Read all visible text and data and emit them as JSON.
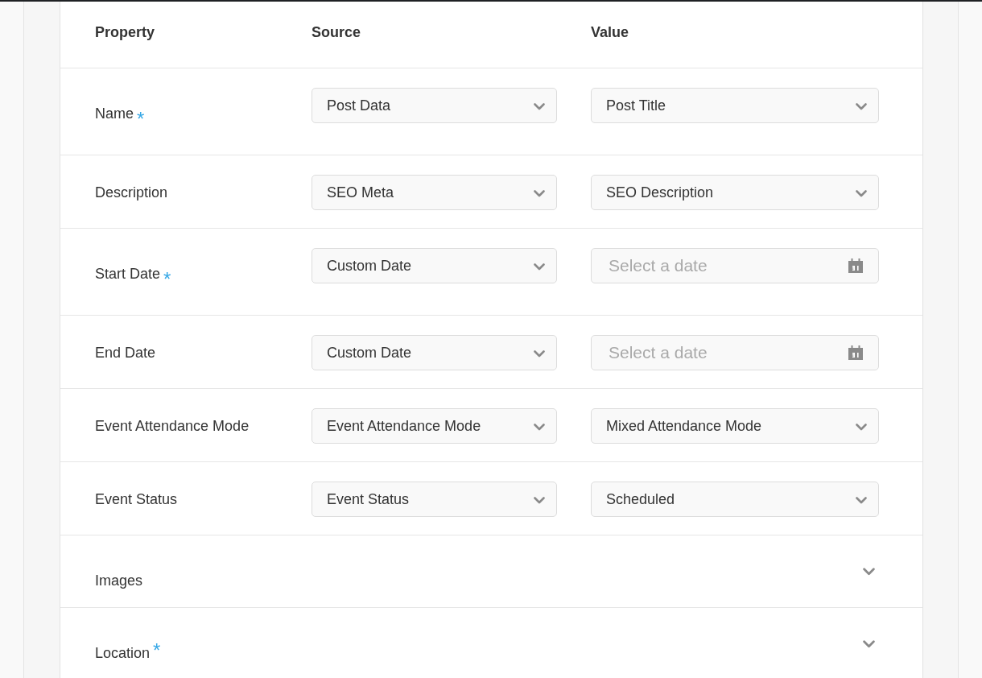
{
  "table": {
    "columns": [
      {
        "label": "Property"
      },
      {
        "label": "Source"
      },
      {
        "label": "Value"
      }
    ],
    "required_mark": "*",
    "rows": [
      {
        "kind": "mapping",
        "label": "Name",
        "required": true,
        "source": "Post Data",
        "value": {
          "kind": "select",
          "text": "Post Title"
        }
      },
      {
        "kind": "mapping",
        "label": "Description",
        "required": false,
        "source": "SEO Meta",
        "value": {
          "kind": "select",
          "text": "SEO Description"
        }
      },
      {
        "kind": "mapping",
        "label": "Start Date",
        "required": true,
        "source": "Custom Date",
        "value": {
          "kind": "date",
          "placeholder": "Select a date"
        }
      },
      {
        "kind": "mapping",
        "label": "End Date",
        "required": false,
        "source": "Custom Date",
        "value": {
          "kind": "date",
          "placeholder": "Select a date"
        }
      },
      {
        "kind": "mapping",
        "label": "Event Attendance Mode",
        "required": false,
        "source": "Event Attendance Mode",
        "value": {
          "kind": "select",
          "text": "Mixed Attendance Mode"
        }
      },
      {
        "kind": "mapping",
        "label": "Event Status",
        "required": false,
        "source": "Event Status",
        "value": {
          "kind": "select",
          "text": "Scheduled"
        }
      },
      {
        "kind": "section",
        "label": "Images",
        "required": false,
        "expanded": false
      },
      {
        "kind": "section",
        "label": "Location",
        "required": true,
        "expanded": false
      }
    ]
  }
}
